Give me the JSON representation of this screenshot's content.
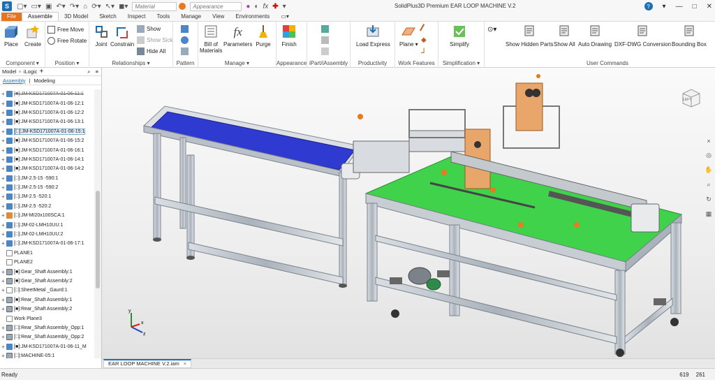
{
  "window": {
    "title": "SolidPlus3D Premium    EAR LOOP MACHINE V.2"
  },
  "toolbar": {
    "material": "Material",
    "appearance": "Appearance"
  },
  "tabs": [
    {
      "label": "File"
    },
    {
      "label": "Assemble"
    },
    {
      "label": "3D Model"
    },
    {
      "label": "Sketch"
    },
    {
      "label": "Inspect"
    },
    {
      "label": "Tools"
    },
    {
      "label": "Manage"
    },
    {
      "label": "View"
    },
    {
      "label": "Environments"
    }
  ],
  "ribbon": {
    "component": {
      "label": "Component ▾",
      "place": "Place",
      "create": "Create"
    },
    "position": {
      "label": "Position ▾",
      "free_move": "Free Move",
      "free_rotate": "Free Rotate"
    },
    "relationships": {
      "label": "Relationships ▾",
      "joint": "Joint",
      "constrain": "Constrain",
      "show": "Show",
      "show_sick": "Show Sick",
      "hide_all": "Hide All"
    },
    "pattern": {
      "label": "Pattern"
    },
    "manage": {
      "label": "Manage ▾",
      "bom": "Bill of Materials",
      "bom1": "Bill of",
      "bom2": "Materials",
      "parameters": "Parameters",
      "purge": "Purge"
    },
    "appearance": {
      "label": "Appearance",
      "finish": "Finish"
    },
    "ipart": {
      "label": "iPart/iAssembly"
    },
    "productivity": {
      "label": "Productivity",
      "load_express": "Load Express"
    },
    "work_features": {
      "label": "Work Features",
      "plane": "Plane ▾"
    },
    "simplification": {
      "label": "Simplification ▾",
      "simplify": "Simplify"
    },
    "user_commands": {
      "label": "User Commands",
      "items": [
        "Show Hidden Parts",
        "Show All",
        "Auto Drawing",
        "DXF-DWG Conversion",
        "Bounding Box"
      ]
    }
  },
  "panel": {
    "tab_model": "Model",
    "tab_ilogic": "iLogic",
    "add": "+",
    "menu": "≡",
    "sub_assembly": "Assembly",
    "sub_modeling": "Modeling",
    "tree": [
      {
        "pm": "+",
        "icon": "blue",
        "text": "[■]:JM-KSD171007A-01-06-11:1",
        "style": "strike"
      },
      {
        "pm": "+",
        "icon": "blue",
        "text": "[■]:JM-KSD171007A-01-06-12:1"
      },
      {
        "pm": "+",
        "icon": "blue",
        "text": "[■]:JM-KSD171007A-01-06-12:2"
      },
      {
        "pm": "+",
        "icon": "blue",
        "text": "[■]:JM-KSD171007A-01-06-13:1"
      },
      {
        "pm": "+",
        "icon": "blue",
        "text": "[□]:JM-KSD171007A-01-06-15:1",
        "style": "sel"
      },
      {
        "pm": "+",
        "icon": "blue",
        "text": "[■]:JM-KSD171007A-01-06-15:2"
      },
      {
        "pm": "+",
        "icon": "blue",
        "text": "[■]:JM-KSD171007A-01-06-16:1"
      },
      {
        "pm": "+",
        "icon": "blue",
        "text": "[■]:JM-KSD171007A-01-06-14:1"
      },
      {
        "pm": "+",
        "icon": "blue",
        "text": "[■]:JM-KSD171007A-01-06-14:2"
      },
      {
        "pm": "+",
        "icon": "blue",
        "text": "[□]:JM-2.5-15 -590:1"
      },
      {
        "pm": "+",
        "icon": "blue",
        "text": "[□]:JM-2.5-15 -590:2"
      },
      {
        "pm": "+",
        "icon": "blue",
        "text": "[□]:JM-2.5 -520:1"
      },
      {
        "pm": "+",
        "icon": "blue",
        "text": "[□]:JM-2.5 -520:2"
      },
      {
        "pm": "+",
        "icon": "orange",
        "text": "[□]:JM-MI20x100SCA:1"
      },
      {
        "pm": "+",
        "icon": "blue",
        "text": "[□]:JM-02-LMH10UU:1"
      },
      {
        "pm": "+",
        "icon": "blue",
        "text": "[□]:JM-02-LMH10UU:2"
      },
      {
        "pm": "+",
        "icon": "blue",
        "text": "[□]:JM-KSD171007A-01-06-17:1"
      },
      {
        "pm": "",
        "icon": "plane",
        "text": "PLANE1"
      },
      {
        "pm": "",
        "icon": "plane",
        "text": "PLANE2"
      },
      {
        "pm": "+",
        "icon": "assy",
        "text": "[■]:Gear_Shaft Assembly:1"
      },
      {
        "pm": "+",
        "icon": "assy",
        "text": "[■]:Gear_Shaft Assembly:2"
      },
      {
        "pm": "+",
        "icon": "plane",
        "text": "[□]:SheetMetal _Gaurd:1"
      },
      {
        "pm": "+",
        "icon": "assy",
        "text": "[■]:Rear_Shaft Assembly:1"
      },
      {
        "pm": "+",
        "icon": "assy",
        "text": "[■]:Rear_Shaft Assembly:2"
      },
      {
        "pm": "",
        "icon": "plane",
        "text": "Work Plane3"
      },
      {
        "pm": "+",
        "icon": "assy",
        "text": "[□]:Rear_Shaft Assembly_Opp:1"
      },
      {
        "pm": "+",
        "icon": "assy",
        "text": "[□]:Rear_Shaft Assembly_Opp:2"
      },
      {
        "pm": "+",
        "icon": "blue",
        "text": "[■]:JM-KSD171007A-01-06-11_M"
      },
      {
        "pm": "+",
        "icon": "assy",
        "text": "[□]:MACHINE-05:1"
      }
    ]
  },
  "viewcube": {
    "face": "LEFT"
  },
  "document_tab": {
    "label": "EAR LOOP MACHINE V.2.iam",
    "close": "×"
  },
  "status": {
    "ready": "Ready",
    "x": "619",
    "y": "261"
  },
  "colors": {
    "file_tab": "#E5731F",
    "accent": "#1B6FB5",
    "conveyor_belt": "#2E3AD0",
    "table_top": "#3FD24A",
    "frame": "#B8BFC8"
  }
}
